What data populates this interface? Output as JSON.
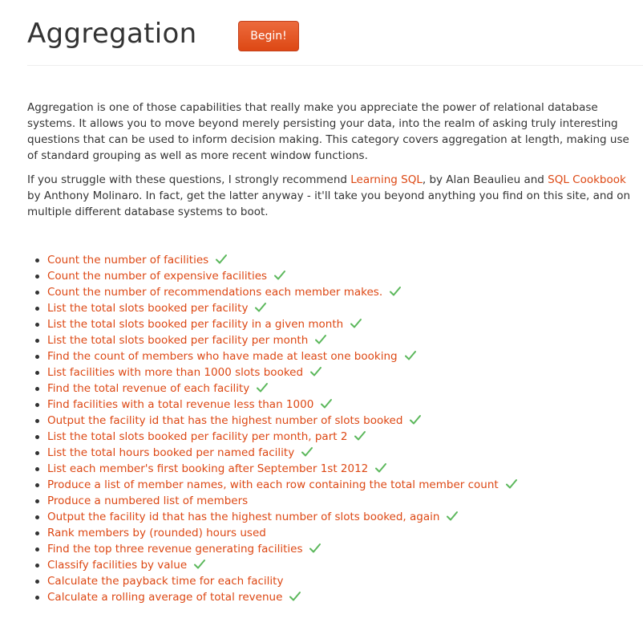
{
  "header": {
    "title": "Aggregation",
    "begin_label": "Begin!"
  },
  "intro": {
    "paragraph1": "Aggregation is one of those capabilities that really make you appreciate the power of relational database systems. It allows you to move beyond merely persisting your data, into the realm of asking truly interesting questions that can be used to inform decision making. This category covers aggregation at length, making use of standard grouping as well as more recent window functions.",
    "p2_part1": "If you struggle with these questions, I strongly recommend ",
    "p2_link1": "Learning SQL",
    "p2_part2": ", by Alan Beaulieu and ",
    "p2_link2": "SQL Cookbook",
    "p2_part3": " by Anthony Molinaro. In fact, get the latter anyway - it'll take you beyond anything you find on this site, and on multiple different database systems to boot."
  },
  "colors": {
    "link": "#dd4814",
    "check": "#5cb85c",
    "button": "#dd4814"
  },
  "exercises": [
    {
      "label": "Count the number of facilities",
      "completed": true
    },
    {
      "label": "Count the number of expensive facilities",
      "completed": true
    },
    {
      "label": "Count the number of recommendations each member makes.",
      "completed": true
    },
    {
      "label": "List the total slots booked per facility",
      "completed": true
    },
    {
      "label": "List the total slots booked per facility in a given month",
      "completed": true
    },
    {
      "label": "List the total slots booked per facility per month",
      "completed": true
    },
    {
      "label": "Find the count of members who have made at least one booking",
      "completed": true
    },
    {
      "label": "List facilities with more than 1000 slots booked",
      "completed": true
    },
    {
      "label": "Find the total revenue of each facility",
      "completed": true
    },
    {
      "label": "Find facilities with a total revenue less than 1000",
      "completed": true
    },
    {
      "label": "Output the facility id that has the highest number of slots booked",
      "completed": true
    },
    {
      "label": "List the total slots booked per facility per month, part 2",
      "completed": true
    },
    {
      "label": "List the total hours booked per named facility",
      "completed": true
    },
    {
      "label": "List each member's first booking after September 1st 2012",
      "completed": true
    },
    {
      "label": "Produce a list of member names, with each row containing the total member count",
      "completed": true
    },
    {
      "label": "Produce a numbered list of members",
      "completed": false
    },
    {
      "label": "Output the facility id that has the highest number of slots booked, again",
      "completed": true
    },
    {
      "label": "Rank members by (rounded) hours used",
      "completed": false
    },
    {
      "label": "Find the top three revenue generating facilities",
      "completed": true
    },
    {
      "label": "Classify facilities by value",
      "completed": true
    },
    {
      "label": "Calculate the payback time for each facility",
      "completed": false
    },
    {
      "label": "Calculate a rolling average of total revenue",
      "completed": true
    }
  ]
}
